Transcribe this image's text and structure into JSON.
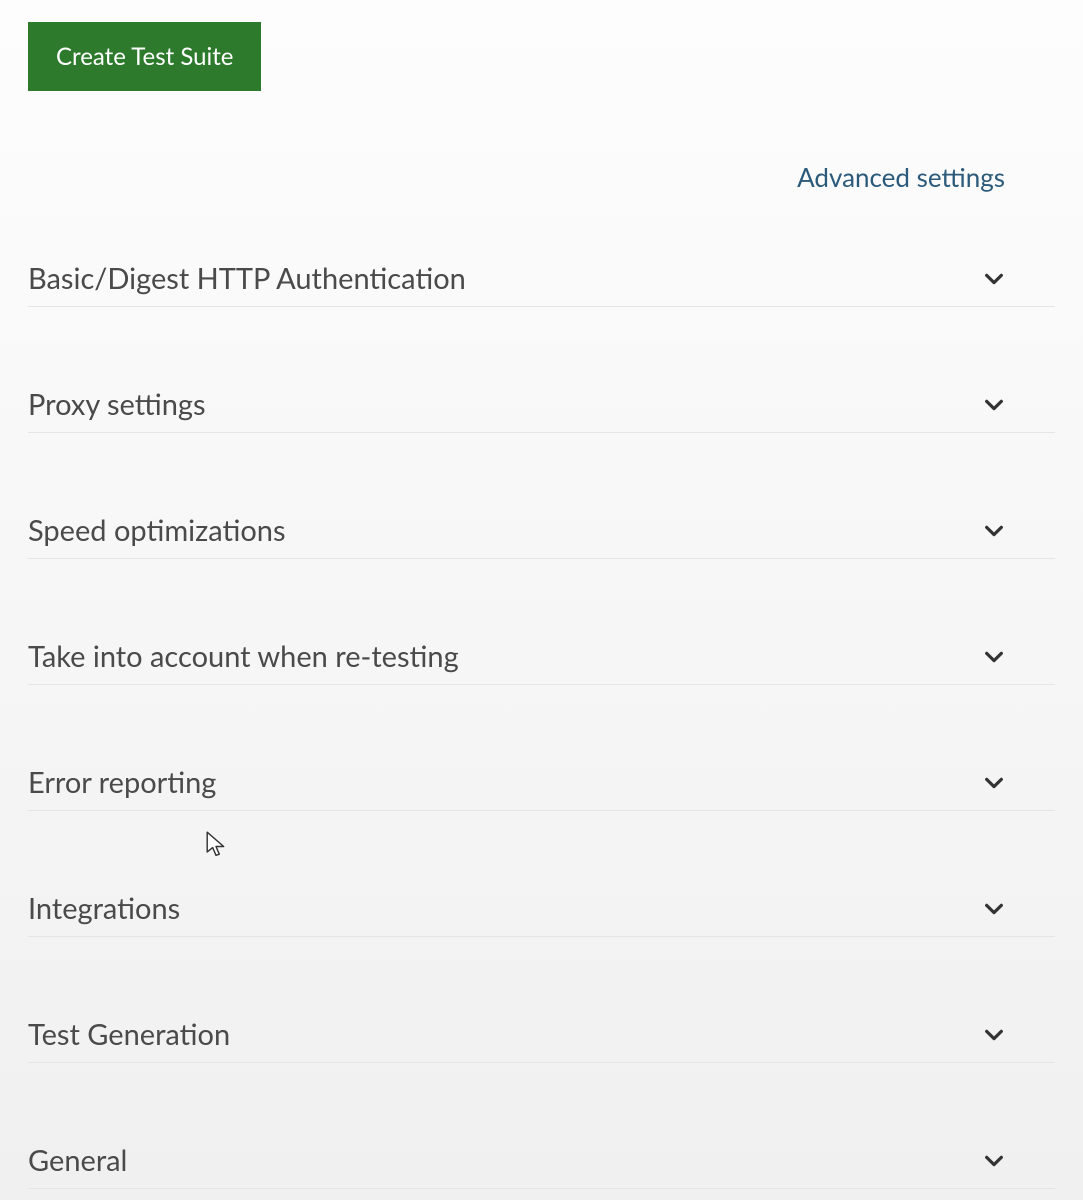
{
  "header": {
    "create_button_label": "Create Test Suite",
    "advanced_link_label": "Advanced settings"
  },
  "sections": [
    {
      "label": "Basic/Digest HTTP Authentication"
    },
    {
      "label": "Proxy settings"
    },
    {
      "label": "Speed optimizations"
    },
    {
      "label": "Take into account when re-testing"
    },
    {
      "label": "Error reporting"
    },
    {
      "label": "Integrations"
    },
    {
      "label": "Test Generation"
    },
    {
      "label": "General"
    }
  ]
}
